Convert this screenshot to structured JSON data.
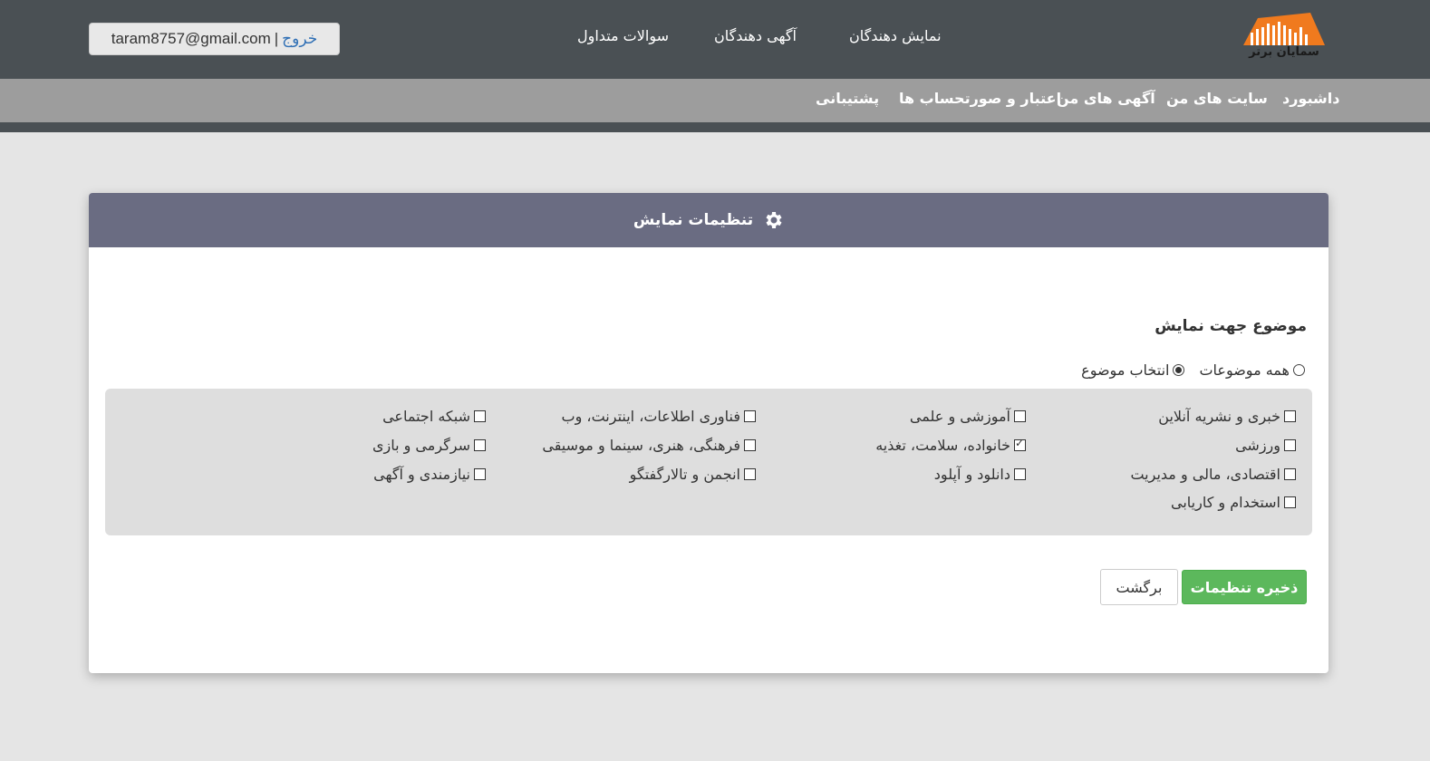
{
  "header": {
    "logo_text": "سمایان برتر",
    "nav": [
      "نمایش دهندگان",
      "آگهی دهندگان",
      "سوالات متداول"
    ],
    "account": {
      "email": "taram8757@gmail.com",
      "separator": "|",
      "logout": "خروج"
    }
  },
  "subnav": [
    "داشبورد",
    "سایت های من",
    "آگهی های من",
    "اعتبار و صورتحساب ها",
    "پشتیبانی"
  ],
  "card": {
    "title": "تنظیمات نمایش",
    "title_icon": "gear-icon",
    "section_title": "موضوع جهت نمایش",
    "radios": [
      {
        "label": "همه موضوعات",
        "checked": false
      },
      {
        "label": "انتخاب موضوع",
        "checked": true
      }
    ],
    "topics": [
      {
        "label": "خبری و نشریه آنلاین",
        "checked": false
      },
      {
        "label": "آموزشی و علمی",
        "checked": false
      },
      {
        "label": "فناوری اطلاعات، اینترنت، وب",
        "checked": false
      },
      {
        "label": "شبکه اجتماعی",
        "checked": false
      },
      {
        "label": "ورزشی",
        "checked": false
      },
      {
        "label": "خانواده، سلامت، تغذیه",
        "checked": true
      },
      {
        "label": "فرهنگی، هنری، سینما و موسیقی",
        "checked": false
      },
      {
        "label": "سرگرمی و بازی",
        "checked": false
      },
      {
        "label": "اقتصادی، مالی و مدیریت",
        "checked": false
      },
      {
        "label": "دانلود و آپلود",
        "checked": false
      },
      {
        "label": "انجمن و تالارگفتگو",
        "checked": false
      },
      {
        "label": "نیازمندی و آگهی",
        "checked": false
      },
      {
        "label": "استخدام و کاریابی",
        "checked": false
      }
    ],
    "save_label": "ذخیره تنظیمات",
    "back_label": "برگشت"
  },
  "colors": {
    "topbar": "#4a5054",
    "subnav": "#9d9d9d",
    "card_header": "#6a6c82",
    "save_button": "#5cb85c",
    "logo_orange": "#f07a1e"
  }
}
